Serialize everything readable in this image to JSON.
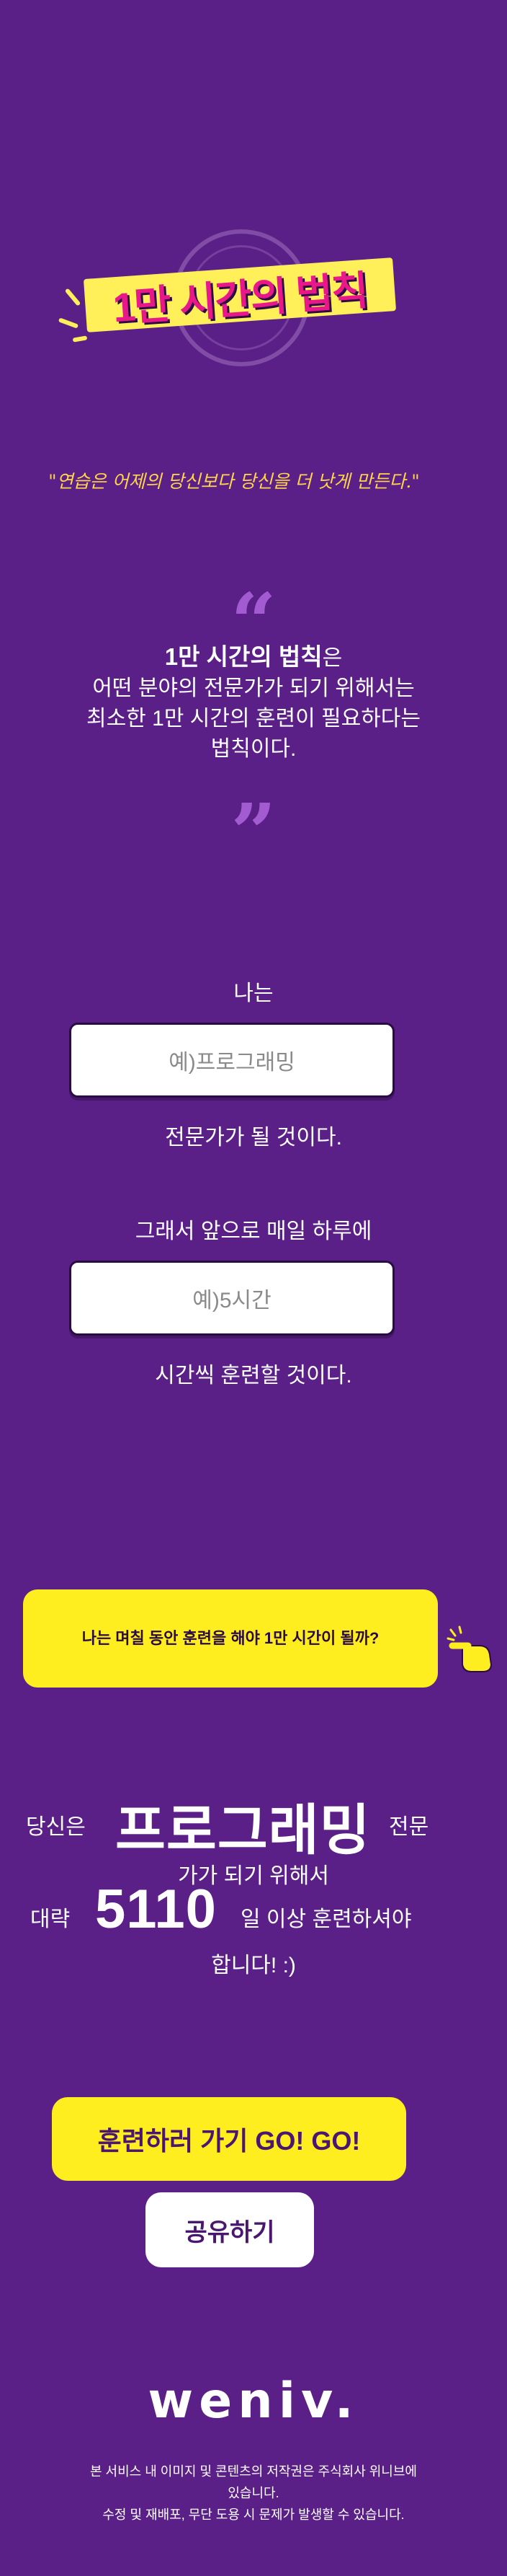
{
  "logo": {
    "text": "1만 시간의 법칙",
    "icon": "clock-icon"
  },
  "quote": "\"연습은 어제의 당신보다 당신을 더 낫게 만든다.\"",
  "law": {
    "open_mark": "“",
    "close_mark": "”",
    "title": "1만 시간의 법칙",
    "title_suffix": "은",
    "line1": "어떤 분야의 전문가가 되기 위해서는",
    "line2": "최소한 1만 시간의 훈련이 필요하다는",
    "line3": "법칙이다."
  },
  "form": {
    "label_i": "나는",
    "field_placeholder": "예)프로그래밍",
    "label_expert": "전문가가 될 것이다.",
    "label_daily": "그래서 앞으로 매일 하루에",
    "time_placeholder": "예)5시간",
    "label_train": "시간씩 훈련할 것이다."
  },
  "calc_button": "나는 며칠 동안 훈련을 해야 1만 시간이 될까?",
  "result": {
    "you": "당신은",
    "field": "프로그래밍",
    "expert": "전문",
    "line2": "가가 되기 위해서",
    "approx": "대략",
    "days": "5110",
    "days_suffix": "일 이상 훈련하셔야",
    "end": "합니다! :)"
  },
  "go_button": "훈련하러 가기 GO! GO!",
  "share_button": "공유하기",
  "footer": {
    "brand": "weniv.",
    "line1": "본 서비스 내 이미지 및 콘텐츠의 저작권은 주식회사 위니브에",
    "line2": "있습니다.",
    "line3": "수정 및 재배포, 무단 도용 시 문제가 발생할 수 있습니다."
  },
  "colors": {
    "background": "#5b2088",
    "accent_yellow": "#ffee1f",
    "quote_yellow": "#ffd54a",
    "logo_pink": "#e8178a"
  }
}
